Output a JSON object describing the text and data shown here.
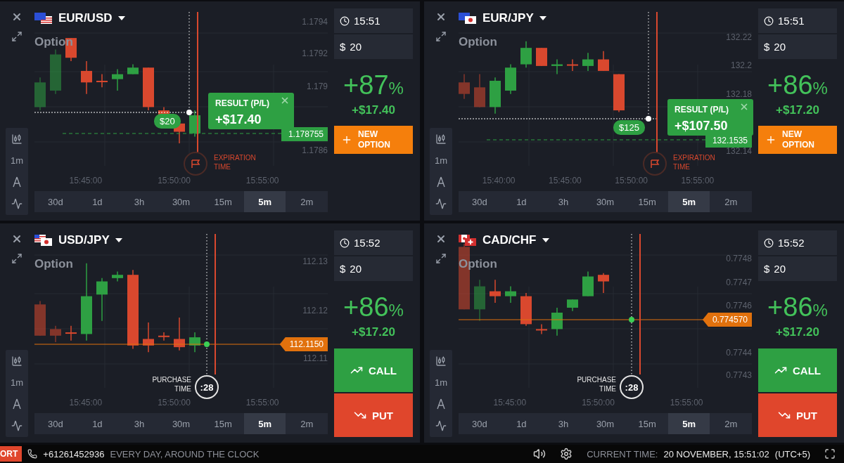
{
  "panels": [
    {
      "pair": "EUR/USD",
      "flag": {
        "kind": "eu_us"
      },
      "mode": "Option",
      "tool_label": "1m",
      "price_labels": [
        "1.1794",
        "1.1792",
        "1.179",
        "1.1786"
      ],
      "time_labels": [
        "15:45:00",
        "15:50:00",
        "15:55:00"
      ],
      "price_tag": {
        "text": "1.178755",
        "kind": "green"
      },
      "overlay": {
        "kind": "result",
        "title": "RESULT (P/L)",
        "value": "+$17.40",
        "bet": "$20",
        "marker": "EXPIRATION TIME"
      },
      "time": "15:51",
      "currency": "$",
      "amount": "20",
      "percent": "+87",
      "percent_sign": "%",
      "profit": "+$17.40",
      "actions": [
        {
          "kind": "new",
          "label": "NEW OPTION"
        }
      ],
      "timeframes": [
        {
          "label": "30d",
          "selected": false
        },
        {
          "label": "1d",
          "selected": false
        },
        {
          "label": "3h",
          "selected": false
        },
        {
          "label": "30m",
          "selected": false
        },
        {
          "label": "15m",
          "selected": false
        },
        {
          "label": "5m",
          "selected": true
        },
        {
          "label": "2m",
          "selected": false
        }
      ]
    },
    {
      "pair": "EUR/JPY",
      "flag": {
        "kind": "eu_jp"
      },
      "mode": "Option",
      "tool_label": "1m",
      "price_labels": [
        "132.22",
        "132.2",
        "132.18",
        "132.14"
      ],
      "time_labels": [
        "15:40:00",
        "15:45:00",
        "15:50:00",
        "15:55:00"
      ],
      "price_tag": {
        "text": "132.1535",
        "kind": "green"
      },
      "overlay": {
        "kind": "result",
        "title": "RESULT (P/L)",
        "value": "+$107.50",
        "bet": "$125",
        "marker": "EXPIRATION TIME"
      },
      "time": "15:51",
      "currency": "$",
      "amount": "20",
      "percent": "+86",
      "percent_sign": "%",
      "profit": "+$17.20",
      "actions": [
        {
          "kind": "new",
          "label": "NEW OPTION"
        }
      ],
      "timeframes": [
        {
          "label": "30d",
          "selected": false
        },
        {
          "label": "1d",
          "selected": false
        },
        {
          "label": "3h",
          "selected": false
        },
        {
          "label": "30m",
          "selected": false
        },
        {
          "label": "15m",
          "selected": false
        },
        {
          "label": "5m",
          "selected": true
        },
        {
          "label": "2m",
          "selected": false
        }
      ]
    },
    {
      "pair": "USD/JPY",
      "flag": {
        "kind": "us_jp"
      },
      "mode": "Option",
      "tool_label": "1m",
      "price_labels": [
        "112.13",
        "112.12",
        "112.11"
      ],
      "time_labels": [
        "15:45:00",
        "15:50:00",
        "15:55:00"
      ],
      "price_tag": {
        "text": "112.1150",
        "kind": "orange"
      },
      "overlay": {
        "kind": "purchase",
        "marker": "PURCHASE TIME",
        "countdown": ":28"
      },
      "time": "15:52",
      "currency": "$",
      "amount": "20",
      "percent": "+86",
      "percent_sign": "%",
      "profit": "+$17.20",
      "actions": [
        {
          "kind": "call",
          "label": "CALL"
        },
        {
          "kind": "put",
          "label": "PUT"
        }
      ],
      "timeframes": [
        {
          "label": "30d",
          "selected": false
        },
        {
          "label": "1d",
          "selected": false
        },
        {
          "label": "3h",
          "selected": false
        },
        {
          "label": "30m",
          "selected": false
        },
        {
          "label": "15m",
          "selected": false
        },
        {
          "label": "5m",
          "selected": true
        },
        {
          "label": "2m",
          "selected": false
        }
      ]
    },
    {
      "pair": "CAD/CHF",
      "flag": {
        "kind": "ca_ch"
      },
      "mode": "Option",
      "tool_label": "1m",
      "price_labels": [
        "0.7748",
        "0.7747",
        "0.7746",
        "0.7744",
        "0.7743"
      ],
      "time_labels": [
        "15:45:00",
        "15:50:00",
        "15:55:00"
      ],
      "price_tag": {
        "text": "0.774570",
        "kind": "orange"
      },
      "overlay": {
        "kind": "purchase",
        "marker": "PURCHASE TIME",
        "countdown": ":28"
      },
      "time": "15:52",
      "currency": "$",
      "amount": "20",
      "percent": "+86",
      "percent_sign": "%",
      "profit": "+$17.20",
      "actions": [
        {
          "kind": "call",
          "label": "CALL"
        },
        {
          "kind": "put",
          "label": "PUT"
        }
      ],
      "timeframes": [
        {
          "label": "30d",
          "selected": false
        },
        {
          "label": "1d",
          "selected": false
        },
        {
          "label": "3h",
          "selected": false
        },
        {
          "label": "30m",
          "selected": false
        },
        {
          "label": "15m",
          "selected": false
        },
        {
          "label": "5m",
          "selected": true
        },
        {
          "label": "2m",
          "selected": false
        }
      ]
    }
  ],
  "footer": {
    "support": "ORT",
    "phone": "+61261452936",
    "hours": "EVERY DAY, AROUND THE CLOCK",
    "time_label": "CURRENT TIME:",
    "time_value": "20 NOVEMBER, 15:51:02",
    "timezone": "(UTC+5)"
  }
}
